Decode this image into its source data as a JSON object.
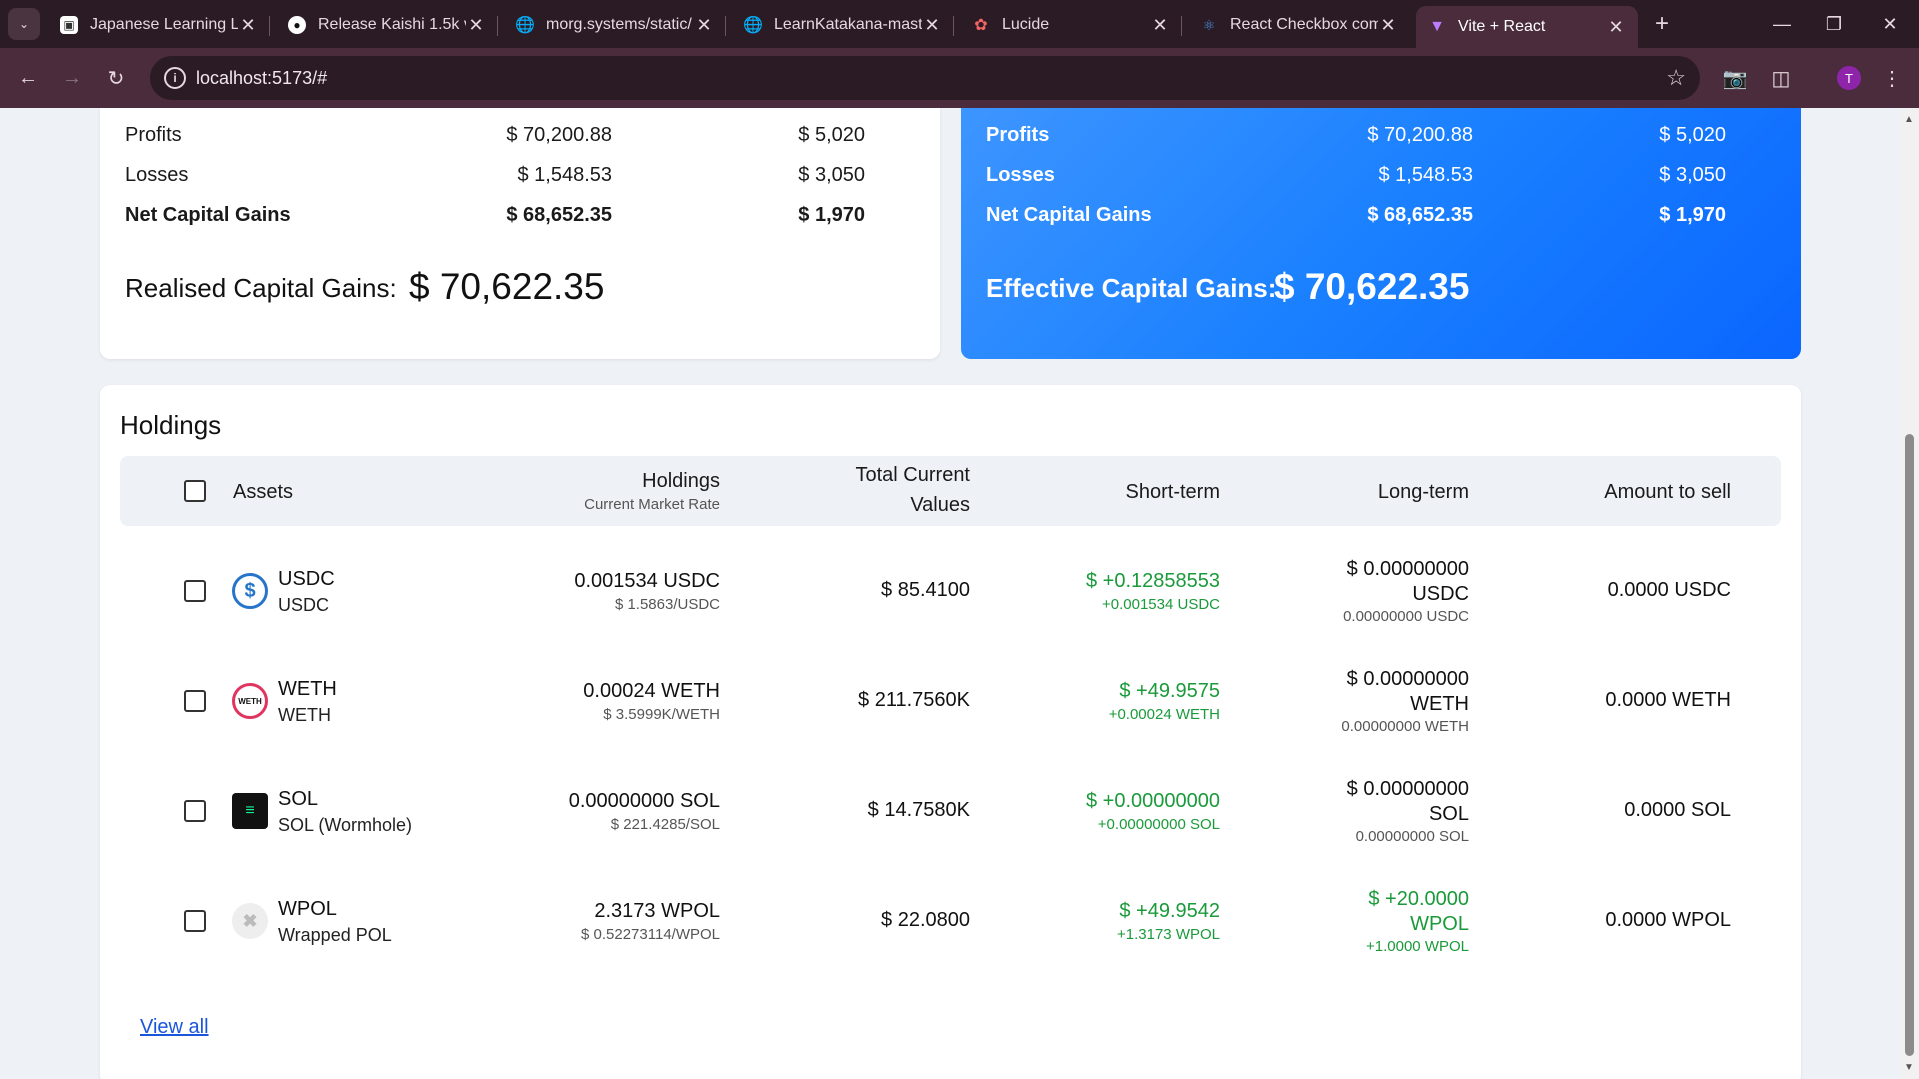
{
  "browser": {
    "tabs": [
      {
        "title": "Japanese Learning Lo",
        "icon": "page-icon",
        "active": false
      },
      {
        "title": "Release Kaishi 1.5k v",
        "icon": "github-icon",
        "active": false
      },
      {
        "title": "morg.systems/static/",
        "icon": "globe-icon",
        "active": false
      },
      {
        "title": "LearnKatakana-maste",
        "icon": "globe-icon",
        "active": false
      },
      {
        "title": "Lucide",
        "icon": "lucide-icon",
        "active": false
      },
      {
        "title": "React Checkbox com",
        "icon": "react-icon",
        "active": false
      },
      {
        "title": "Vite + React",
        "icon": "vite-icon",
        "active": true
      }
    ],
    "url": "localhost:5173/#",
    "profile_initial": "T"
  },
  "pre_harvest": {
    "rows": [
      {
        "label": "Profits",
        "short": "$ 70,200.88",
        "long": "$ 5,020",
        "bold": false
      },
      {
        "label": "Losses",
        "short": "$ 1,548.53",
        "long": "$ 3,050",
        "bold": false
      },
      {
        "label": "Net Capital Gains",
        "short": "$ 68,652.35",
        "long": "$ 1,970",
        "bold": true
      }
    ],
    "total_label": "Realised Capital Gains:",
    "total_value": "$ 70,622.35"
  },
  "after_harvest": {
    "rows": [
      {
        "label": "Profits",
        "short": "$ 70,200.88",
        "long": "$ 5,020",
        "bold": false
      },
      {
        "label": "Losses",
        "short": "$ 1,548.53",
        "long": "$ 3,050",
        "bold": false
      },
      {
        "label": "Net Capital Gains",
        "short": "$ 68,652.35",
        "long": "$ 1,970",
        "bold": true
      }
    ],
    "total_label": "Effective Capital Gains:",
    "total_value": "$ 70,622.35",
    "gradient_colors": [
      "#3d95ff",
      "#0a66ff"
    ]
  },
  "holdings": {
    "title": "Holdings",
    "headers": {
      "assets": "Assets",
      "holdings": "Holdings",
      "holdings_sub": "Current Market Rate",
      "total_line1": "Total Current",
      "total_line2": "Values",
      "short_term": "Short-term",
      "long_term": "Long-term",
      "amount": "Amount to sell"
    },
    "rows": [
      {
        "symbol": "USDC",
        "name": "USDC",
        "icon": "usdc-icon",
        "holding": "0.001534 USDC",
        "rate": "$ 1.5863/USDC",
        "total": "$ 85.4100",
        "short_main": "$ +0.12858553",
        "short_sub": "+0.001534 USDC",
        "short_positive": true,
        "long_main_1": "$ 0.00000000",
        "long_main_2": "USDC",
        "long_sub": "0.00000000 USDC",
        "long_positive": false,
        "amount": "0.0000 USDC"
      },
      {
        "symbol": "WETH",
        "name": "WETH",
        "icon": "weth-icon",
        "holding": "0.00024 WETH",
        "rate": "$ 3.5999K/WETH",
        "total": "$ 211.7560K",
        "short_main": "$ +49.9575",
        "short_sub": "+0.00024 WETH",
        "short_positive": true,
        "long_main_1": "$ 0.00000000",
        "long_main_2": "WETH",
        "long_sub": "0.00000000 WETH",
        "long_positive": false,
        "amount": "0.0000 WETH"
      },
      {
        "symbol": "SOL",
        "name": "SOL (Wormhole)",
        "icon": "sol-icon",
        "holding": "0.00000000 SOL",
        "rate": "$ 221.4285/SOL",
        "total": "$ 14.7580K",
        "short_main": "$ +0.00000000",
        "short_sub": "+0.00000000 SOL",
        "short_positive": true,
        "long_main_1": "$ 0.00000000",
        "long_main_2": "SOL",
        "long_sub": "0.00000000 SOL",
        "long_positive": false,
        "amount": "0.0000 SOL"
      },
      {
        "symbol": "WPOL",
        "name": "Wrapped POL",
        "icon": "wpol-icon",
        "holding": "2.3173 WPOL",
        "rate": "$ 0.52273114/WPOL",
        "total": "$ 22.0800",
        "short_main": "$ +49.9542",
        "short_sub": "+1.3173 WPOL",
        "short_positive": true,
        "long_main_1": "$ +20.0000",
        "long_main_2": "WPOL",
        "long_sub": "+1.0000 WPOL",
        "long_positive": true,
        "amount": "0.0000 WPOL"
      }
    ],
    "view_all": "View all",
    "positive_color": "#1a9a3a"
  }
}
